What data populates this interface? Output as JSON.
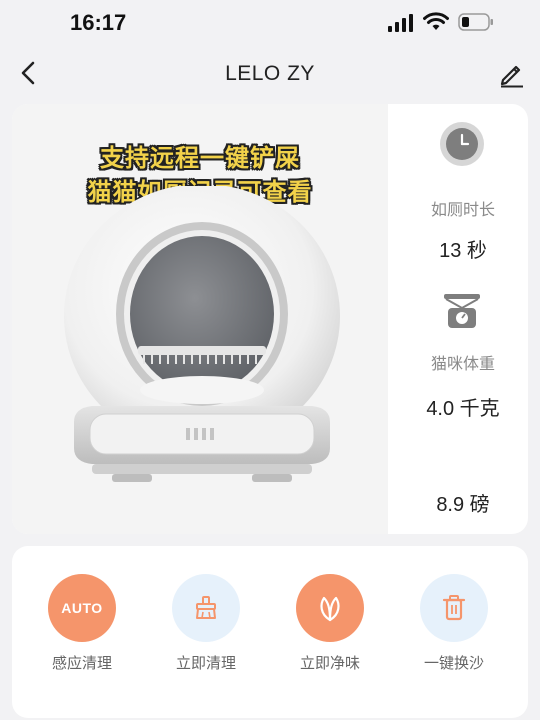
{
  "status_bar": {
    "time": "16:17"
  },
  "nav": {
    "title": "LELO ZY"
  },
  "promo": {
    "line1": "支持远程一键铲屎",
    "line2": "猫猫如厕记录可查看"
  },
  "stats": {
    "duration": {
      "label": "如厕时长",
      "value": "13 秒",
      "icon": "clock-icon"
    },
    "weight": {
      "label": "猫咪体重",
      "value": "4.0 千克",
      "icon": "scale-icon"
    },
    "weight_lb": {
      "value": "8.9 磅"
    }
  },
  "actions": [
    {
      "label": "感应清理",
      "icon_text": "AUTO",
      "icon": "auto-icon",
      "color": "#f5956b"
    },
    {
      "label": "立即清理",
      "icon": "sweep-icon",
      "color": "#e6f1fb"
    },
    {
      "label": "立即净味",
      "icon": "leaf-icon",
      "color": "#f5956b"
    },
    {
      "label": "一键换沙",
      "icon": "trash-icon",
      "color": "#e6f1fb"
    }
  ],
  "colors": {
    "accent": "#f5956b",
    "soft_blue": "#e6f1fb",
    "background": "#f2f2f4"
  }
}
